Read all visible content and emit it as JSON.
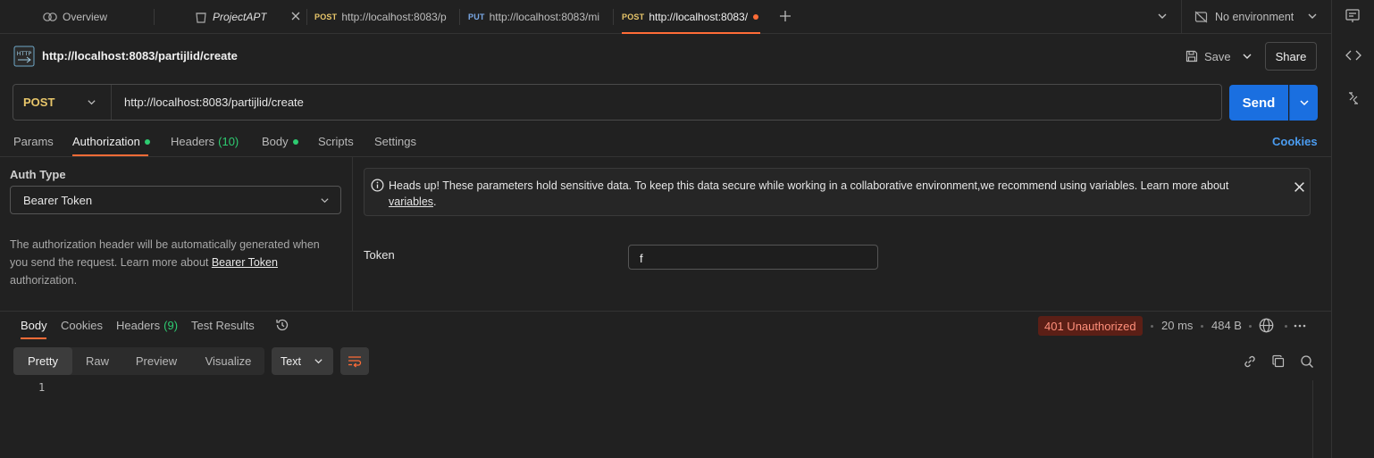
{
  "tabs": {
    "overview_label": "Overview",
    "collection_label": "ProjectAPT",
    "items": [
      {
        "method": "POST",
        "label": "http://localhost:8083/p"
      },
      {
        "method": "PUT",
        "label": "http://localhost:8083/mi"
      },
      {
        "method": "POST",
        "label": "http://localhost:8083/"
      }
    ],
    "environment": "No environment"
  },
  "request": {
    "title": "http://localhost:8083/partijlid/create",
    "save_label": "Save",
    "share_label": "Share",
    "method": "POST",
    "url": "http://localhost:8083/partijlid/create",
    "send_label": "Send"
  },
  "request_tabs": {
    "params": "Params",
    "authorization": "Authorization",
    "headers": "Headers",
    "headers_count": "(10)",
    "body": "Body",
    "scripts": "Scripts",
    "settings": "Settings",
    "cookies": "Cookies"
  },
  "auth": {
    "type_label": "Auth Type",
    "type_value": "Bearer Token",
    "desc_part1": "The authorization header will be automatically generated when you send the request. Learn more about ",
    "desc_link": "Bearer Token",
    "desc_part2": " authorization.",
    "notice_text": "Heads up! These parameters hold sensitive data. To keep this data secure while working in a collaborative environment,we recommend using variables. Learn more about ",
    "notice_link": "variables",
    "notice_end": ".",
    "token_label": "Token",
    "token_value": "f"
  },
  "response": {
    "tabs": {
      "body": "Body",
      "cookies": "Cookies",
      "headers": "Headers",
      "headers_count": "(9)",
      "test_results": "Test Results"
    },
    "status": "401 Unauthorized",
    "time": "20 ms",
    "size": "484 B",
    "views": [
      "Pretty",
      "Raw",
      "Preview",
      "Visualize"
    ],
    "format": "Text",
    "line_number": "1"
  },
  "colors": {
    "accent": "#ff6c37",
    "send": "#1a6fe0",
    "post": "#e8c66a",
    "put": "#7aa9e6",
    "error_badge": "#5b1f16"
  }
}
